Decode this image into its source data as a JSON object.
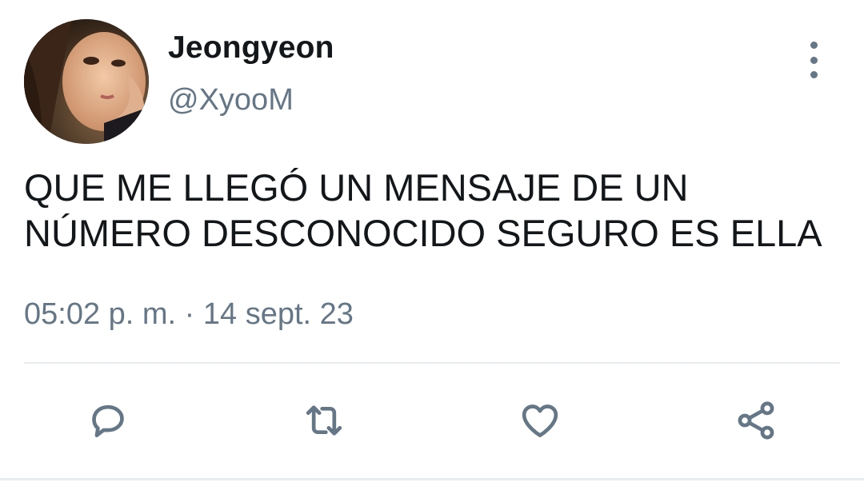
{
  "tweet": {
    "author": {
      "display_name": "Jeongyeon",
      "handle": "@XyooM"
    },
    "text": "QUE ME LLEGÓ UN MENSAJE DE UN NÚMERO DESCONOCIDO SEGURO ES ELLA",
    "timestamp": "05:02 p. m. · 14 sept. 23"
  },
  "icons": {
    "more": "more-vertical-icon",
    "reply": "reply-bubble-icon",
    "retweet": "retweet-icon",
    "like": "heart-icon",
    "share": "share-icon"
  },
  "colors": {
    "text_primary": "#14171a",
    "text_secondary": "#657786",
    "divider": "#e6ecf0",
    "background": "#ffffff"
  }
}
